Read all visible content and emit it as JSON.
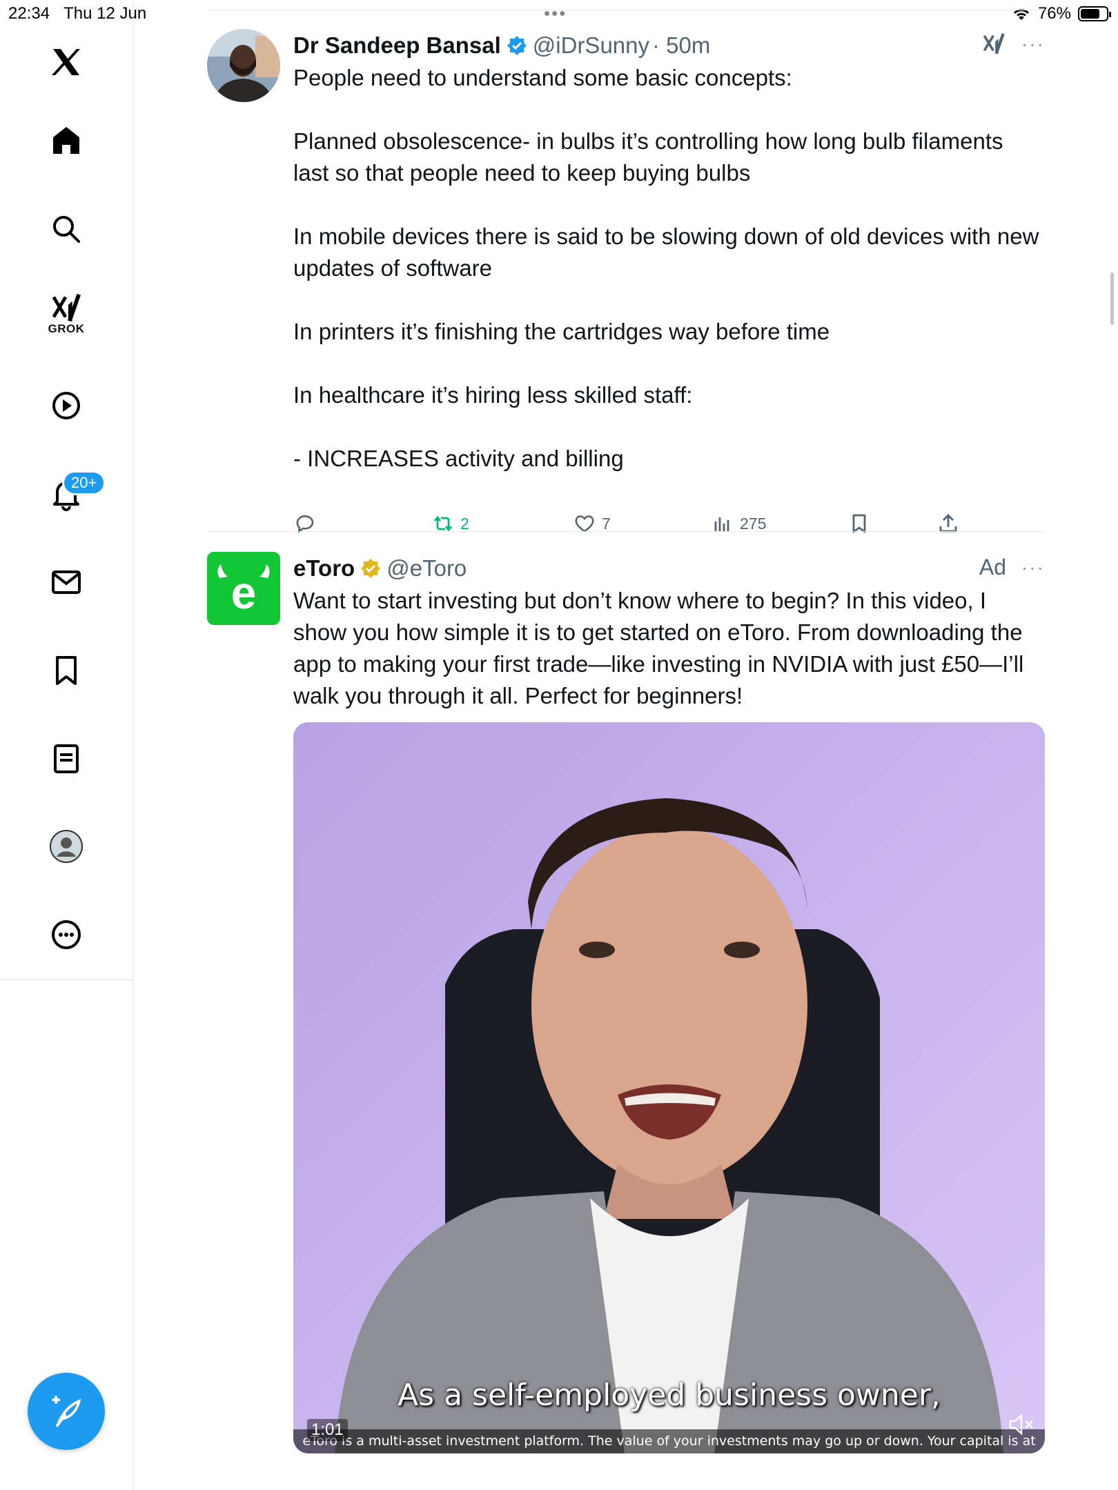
{
  "status_bar": {
    "time": "22:34",
    "date": "Thu 12 Jun",
    "battery": "76%",
    "battery_level": 0.76
  },
  "sidebar": {
    "items": [
      {
        "name": "home",
        "icon": "home-icon"
      },
      {
        "name": "explore",
        "icon": "search-icon"
      },
      {
        "name": "grok",
        "icon": "grok-icon",
        "label": "GROK"
      },
      {
        "name": "videos",
        "icon": "play-icon"
      },
      {
        "name": "notifications",
        "icon": "bell-icon",
        "badge": "20+"
      },
      {
        "name": "messages",
        "icon": "mail-icon"
      },
      {
        "name": "bookmarks",
        "icon": "bookmark-icon"
      },
      {
        "name": "lists",
        "icon": "list-icon"
      },
      {
        "name": "profile",
        "icon": "avatar-icon"
      },
      {
        "name": "more",
        "icon": "more-circle-icon"
      }
    ],
    "compose_icon": "compose-icon"
  },
  "tweet1": {
    "name": "Dr Sandeep Bansal",
    "handle": "@iDrSunny",
    "time": "· 50m",
    "text": "People need to understand some basic concepts:\n\nPlanned obsolescence- in bulbs it’s controlling how long bulb filaments last so that people need to keep buying bulbs\n\nIn mobile devices there is said to be slowing down of old devices with new updates of software\n\nIn printers it’s finishing the cartridges way before time\n\nIn healthcare it’s hiring less skilled staff:\n\n- INCREASES activity and billing",
    "stats": {
      "replies": "",
      "retweets": "2",
      "likes": "7",
      "views": "275"
    },
    "more": "···"
  },
  "tweet2": {
    "name": "eToro",
    "handle": "@eToro",
    "ad_label": "Ad",
    "more": "···",
    "text": "Want to start investing but don’t know where to begin? In this video, I show you how simple it is to get started on eToro. From downloading the app to making your first trade—like investing in NVIDIA with just £50—I’ll walk you through it all. Perfect for beginners!",
    "video": {
      "caption": "As a self-employed business owner,",
      "time": "1:01",
      "disclaimer": "eToro is a multi-asset investment platform. The value of your investments may go up or down. Your capital is at risk."
    }
  },
  "colors": {
    "accent": "#1d9bf0",
    "retweet": "#00ba7c",
    "etoro_green": "#13c636",
    "gold_check": "#e2b719"
  }
}
